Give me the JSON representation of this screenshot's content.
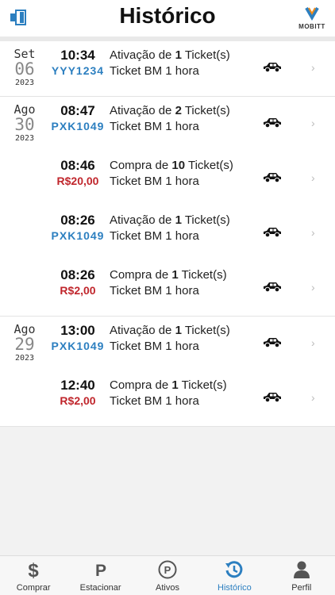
{
  "header": {
    "title": "Histórico",
    "logo_text": "MOBITT",
    "logo_letter": "M"
  },
  "groups": [
    {
      "date": {
        "month": "Set",
        "day": "06",
        "year": "2023"
      },
      "entries": [
        {
          "time": "10:34",
          "sub": "YYY1234",
          "sub_type": "plate",
          "action": "Ativação de",
          "qty": "1",
          "unit": "Ticket(s)",
          "product": "Ticket BM 1 hora"
        }
      ]
    },
    {
      "date": {
        "month": "Ago",
        "day": "30",
        "year": "2023"
      },
      "entries": [
        {
          "time": "08:47",
          "sub": "PXK1049",
          "sub_type": "plate",
          "action": "Ativação de",
          "qty": "2",
          "unit": "Ticket(s)",
          "product": "Ticket BM 1 hora"
        },
        {
          "time": "08:46",
          "sub": "R$20,00",
          "sub_type": "price",
          "action": "Compra de",
          "qty": "10",
          "unit": "Ticket(s)",
          "product": "Ticket BM 1 hora"
        },
        {
          "time": "08:26",
          "sub": "PXK1049",
          "sub_type": "plate",
          "action": "Ativação de",
          "qty": "1",
          "unit": "Ticket(s)",
          "product": "Ticket BM 1 hora"
        },
        {
          "time": "08:26",
          "sub": "R$2,00",
          "sub_type": "price",
          "action": "Compra de",
          "qty": "1",
          "unit": "Ticket(s)",
          "product": "Ticket BM 1 hora"
        }
      ]
    },
    {
      "date": {
        "month": "Ago",
        "day": "29",
        "year": "2023"
      },
      "entries": [
        {
          "time": "13:00",
          "sub": "PXK1049",
          "sub_type": "plate",
          "action": "Ativação de",
          "qty": "1",
          "unit": "Ticket(s)",
          "product": "Ticket BM 1 hora"
        },
        {
          "time": "12:40",
          "sub": "R$2,00",
          "sub_type": "price",
          "action": "Compra de",
          "qty": "1",
          "unit": "Ticket(s)",
          "product": "Ticket BM 1 hora"
        }
      ]
    }
  ],
  "nav": [
    {
      "label": "Comprar",
      "icon": "dollar-icon",
      "glyph": "$",
      "active": false
    },
    {
      "label": "Estacionar",
      "icon": "parking-icon",
      "glyph": "P",
      "active": false
    },
    {
      "label": "Ativos",
      "icon": "parking-circle-icon",
      "glyph": "P",
      "active": false
    },
    {
      "label": "Histórico",
      "icon": "history-icon",
      "glyph": "",
      "active": true
    },
    {
      "label": "Perfil",
      "icon": "user-icon",
      "glyph": "",
      "active": false
    }
  ],
  "colors": {
    "accent": "#2c7fc0",
    "price": "#c0262c"
  }
}
